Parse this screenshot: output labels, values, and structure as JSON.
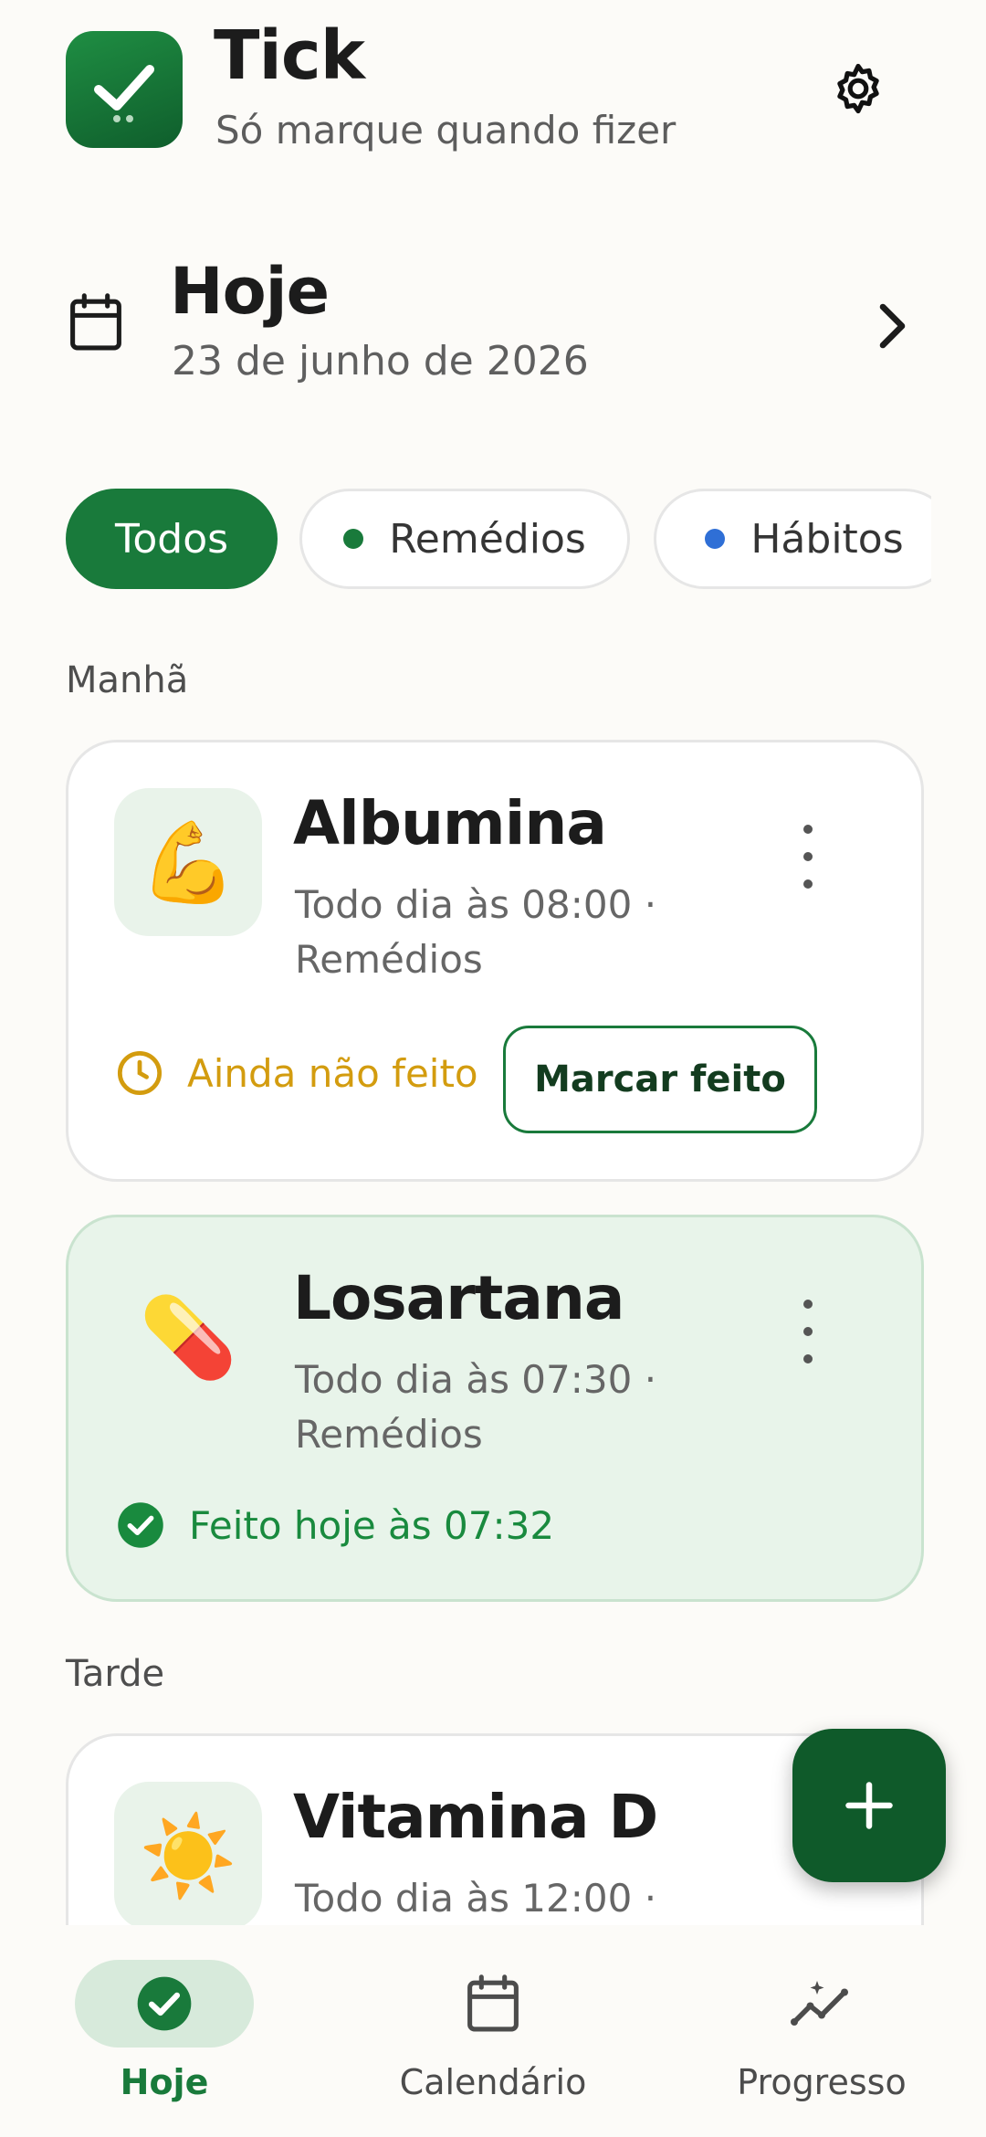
{
  "app": {
    "title": "Tick",
    "subtitle": "Só marque quando fizer"
  },
  "date": {
    "title": "Hoje",
    "subtitle": "23 de junho de 2026"
  },
  "filters": [
    {
      "label": "Todos",
      "selected": true
    },
    {
      "label": "Remédios",
      "dot_color": "#197a3b"
    },
    {
      "label": "Hábitos",
      "dot_color": "#2f6fd6"
    }
  ],
  "sections": {
    "morning": "Manhã",
    "afternoon": "Tarde"
  },
  "cards": [
    {
      "title": "Albumina",
      "emoji": "💪",
      "meta": "Todo dia às 08:00 · Remédios",
      "status": "Ainda não feito",
      "action": "Marcar feito"
    },
    {
      "title": "Losartana",
      "emoji": "💊",
      "meta": "Todo dia às 07:30 · Remédios",
      "status": "Feito hoje às 07:32"
    },
    {
      "title": "Vitamina D",
      "emoji": "☀️",
      "meta": "Todo dia às 12:00 ·"
    }
  ],
  "nav": [
    {
      "label": "Hoje",
      "active": true
    },
    {
      "label": "Calendário"
    },
    {
      "label": "Progresso"
    }
  ],
  "colors": {
    "brand": "#197a3b",
    "brand_dark": "#0f5a2a",
    "pending": "#d39c0f",
    "done_bg": "#e8f4ea"
  }
}
